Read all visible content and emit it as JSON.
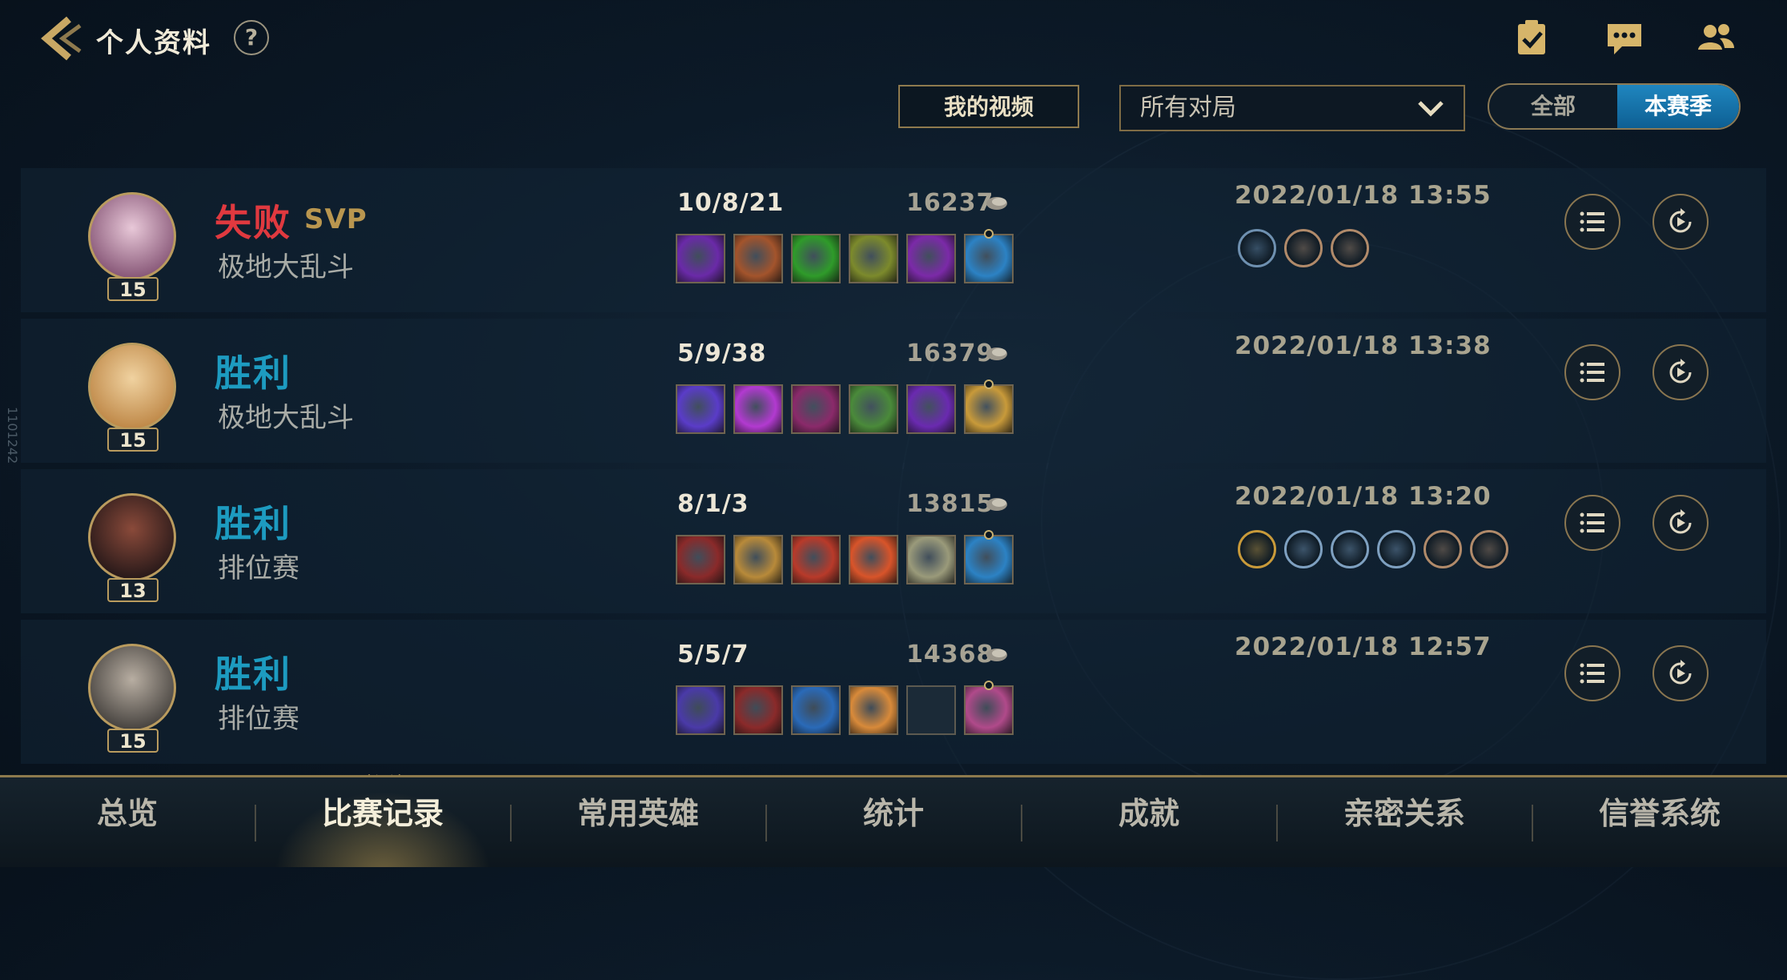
{
  "header": {
    "title": "个人资料",
    "help_label": "?"
  },
  "toolbar": {
    "video_label": "我的视频",
    "filter_value": "所有对局",
    "season_options": [
      "全部",
      "本赛季"
    ],
    "season_selected": "本赛季"
  },
  "matches": [
    {
      "result": "失败",
      "result_type": "lose",
      "svp": "SVP",
      "mode": "极地大乱斗",
      "level": "15",
      "kda": "10/8/21",
      "score": "16237",
      "date": "2022/01/18 13:55",
      "items": [
        "#6a2aa8",
        "#a3542c",
        "#2f9b2a",
        "#7c8a2c",
        "#7b2aa8",
        "#2c82c4"
      ],
      "badges": [
        "#6e90b0",
        "#b08a6a",
        "#b08a6a"
      ]
    },
    {
      "result": "胜利",
      "result_type": "win",
      "svp": "",
      "mode": "极地大乱斗",
      "level": "15",
      "kda": "5/9/38",
      "score": "16379",
      "date": "2022/01/18 13:38",
      "items": [
        "#5a3cc8",
        "#b23ad0",
        "#8a2a6a",
        "#4a8a3a",
        "#6a2ab0",
        "#c89a3a"
      ],
      "badges": []
    },
    {
      "result": "胜利",
      "result_type": "win",
      "svp": "",
      "mode": "排位赛",
      "level": "13",
      "kda": "8/1/3",
      "score": "13815",
      "date": "2022/01/18 13:20",
      "items": [
        "#8a2a2a",
        "#b88a3a",
        "#b83a2a",
        "#d8542a",
        "#9a9a7a",
        "#2c82c4"
      ],
      "badges": [
        "#c89a3a",
        "#7ea0c0",
        "#7ea0c0",
        "#7ea0c0",
        "#b08a6a",
        "#b08a6a"
      ]
    },
    {
      "result": "胜利",
      "result_type": "win",
      "svp": "",
      "mode": "排位赛",
      "level": "15",
      "kda": "5/5/7",
      "score": "14368",
      "date": "2022/01/18 12:57",
      "items": [
        "#4a3aa8",
        "#8a2a2a",
        "#2a6ab8",
        "#d88a3a",
        "",
        "#b04a8a"
      ],
      "badges": []
    }
  ],
  "nav": {
    "tabs": [
      "总览",
      "比赛记录",
      "常用英雄",
      "统计",
      "成就",
      "亲密关系",
      "信誉系统"
    ],
    "active": "比赛记录"
  },
  "side_label": "1101242",
  "colors": {
    "accent_gold": "#b99b5e",
    "lose_red": "#e0393f",
    "win_blue": "#1d9bc0",
    "season_active": "#1f86bf"
  }
}
